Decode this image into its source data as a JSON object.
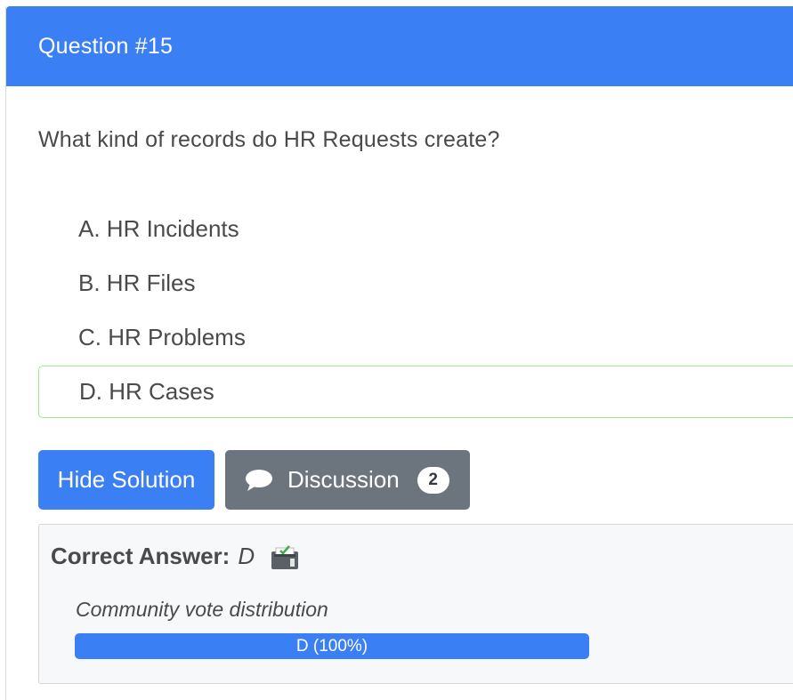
{
  "header": {
    "title": "Question #15"
  },
  "question": {
    "text": "What kind of records do HR Requests create?"
  },
  "choices": [
    {
      "label": "A. HR Incidents",
      "correct": false
    },
    {
      "label": "B. HR Files",
      "correct": false
    },
    {
      "label": "C. HR Problems",
      "correct": false
    },
    {
      "label": "D. HR Cases",
      "correct": true
    }
  ],
  "actions": {
    "hide_solution_label": "Hide Solution",
    "discussion_label": "Discussion",
    "discussion_count": "2"
  },
  "answer": {
    "label": "Correct Answer:",
    "value": "D",
    "vote_title": "Community vote distribution",
    "vote_bar_label": "D (100%)",
    "vote_fraction": 1.0
  },
  "colors": {
    "primary": "#3b7ff5",
    "secondary": "#6c757d",
    "correct_border": "#a7e0a0"
  },
  "icons": {
    "discussion": "speech-bubble-icon",
    "vote": "ballot-box-icon"
  }
}
